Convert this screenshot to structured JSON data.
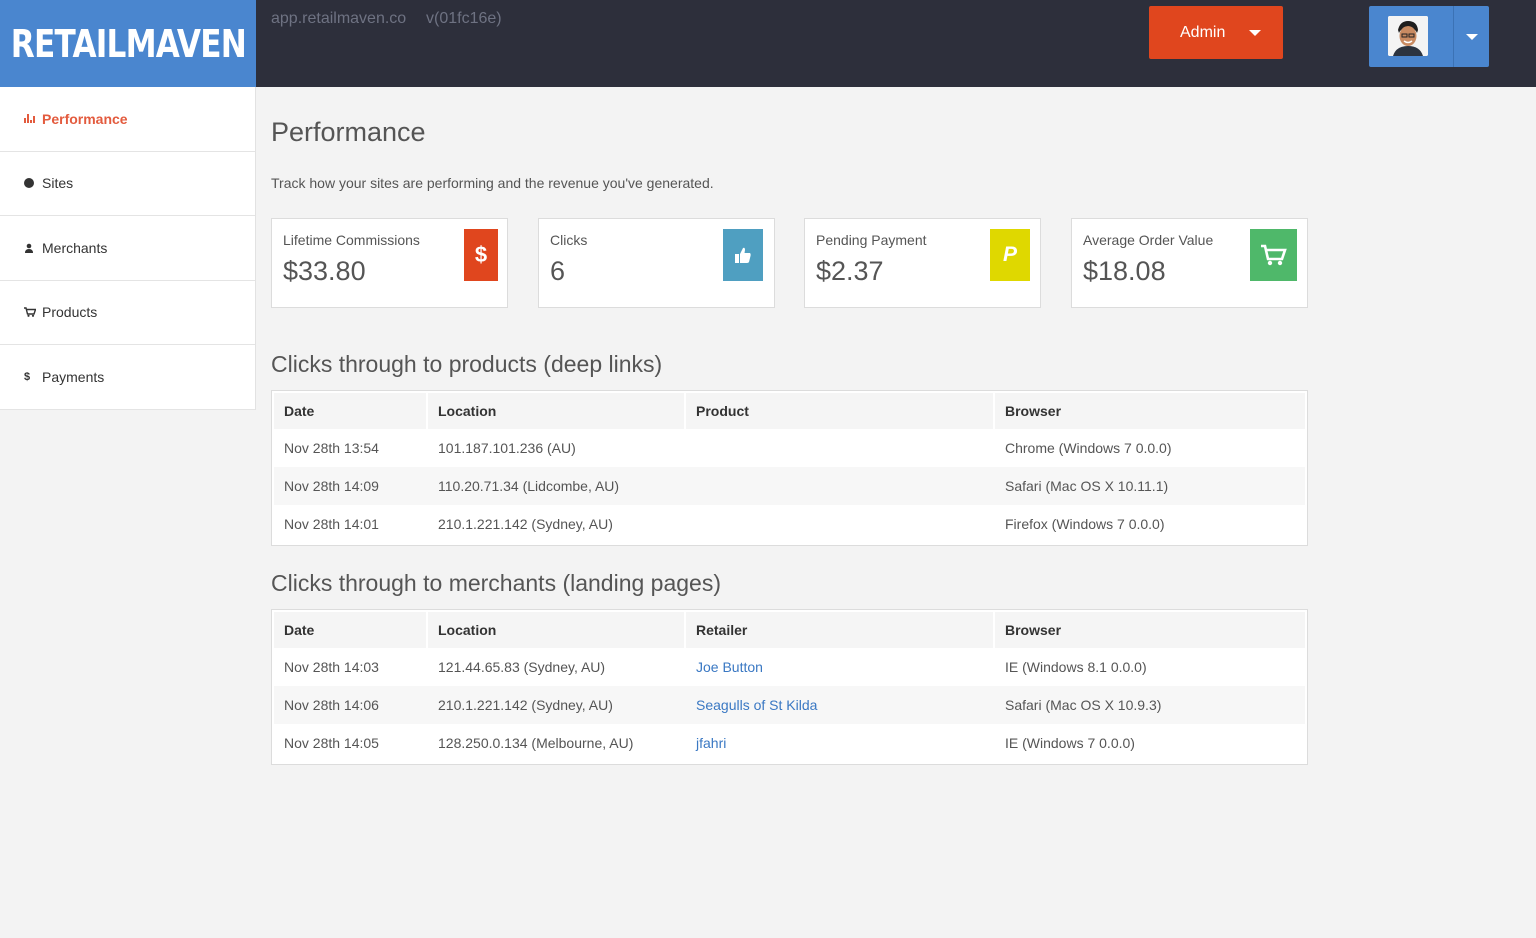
{
  "header": {
    "logo": "RETAILMAVEN",
    "host": "app.retailmaven.co",
    "version": "v(01fc16e)",
    "admin_label": "Admin"
  },
  "sidebar": {
    "items": [
      {
        "label": "Performance",
        "icon": "bar-chart-icon"
      },
      {
        "label": "Sites",
        "icon": "globe-icon"
      },
      {
        "label": "Merchants",
        "icon": "users-icon"
      },
      {
        "label": "Products",
        "icon": "cart-icon"
      },
      {
        "label": "Payments",
        "icon": "dollar-icon"
      }
    ]
  },
  "page": {
    "title": "Performance",
    "description": "Track how your sites are performing and the revenue you've generated."
  },
  "cards": [
    {
      "label": "Lifetime Commissions",
      "value": "$33.80",
      "icon": "dollar-icon",
      "color": "#e0461e"
    },
    {
      "label": "Clicks",
      "value": "6",
      "icon": "thumbs-up-icon",
      "color": "#4f9fc1"
    },
    {
      "label": "Pending Payment",
      "value": "$2.37",
      "icon": "paypal-icon",
      "color": "#dfd800"
    },
    {
      "label": "Average Order Value",
      "value": "$18.08",
      "icon": "cart-icon",
      "color": "#4fb86a"
    }
  ],
  "products_section": {
    "title": "Clicks through to products (deep links)",
    "headers": [
      "Date",
      "Location",
      "Product",
      "Browser"
    ],
    "rows": [
      [
        "Nov 28th 13:54",
        "101.187.101.236 (AU)",
        "",
        "Chrome (Windows 7 0.0.0)"
      ],
      [
        "Nov 28th 14:09",
        "110.20.71.34 (Lidcombe, AU)",
        "",
        "Safari (Mac OS X 10.11.1)"
      ],
      [
        "Nov 28th 14:01",
        "210.1.221.142 (Sydney, AU)",
        "",
        "Firefox (Windows 7 0.0.0)"
      ]
    ]
  },
  "merchants_section": {
    "title": "Clicks through to merchants (landing pages)",
    "headers": [
      "Date",
      "Location",
      "Retailer",
      "Browser"
    ],
    "rows": [
      [
        "Nov 28th 14:03",
        "121.44.65.83 (Sydney, AU)",
        "Joe Button",
        "IE (Windows 8.1 0.0.0)"
      ],
      [
        "Nov 28th 14:06",
        "210.1.221.142 (Sydney, AU)",
        "Seagulls of St Kilda",
        "Safari (Mac OS X 10.9.3)"
      ],
      [
        "Nov 28th 14:05",
        "128.250.0.134 (Melbourne, AU)",
        "jfahri",
        "IE (Windows 7 0.0.0)"
      ]
    ]
  }
}
